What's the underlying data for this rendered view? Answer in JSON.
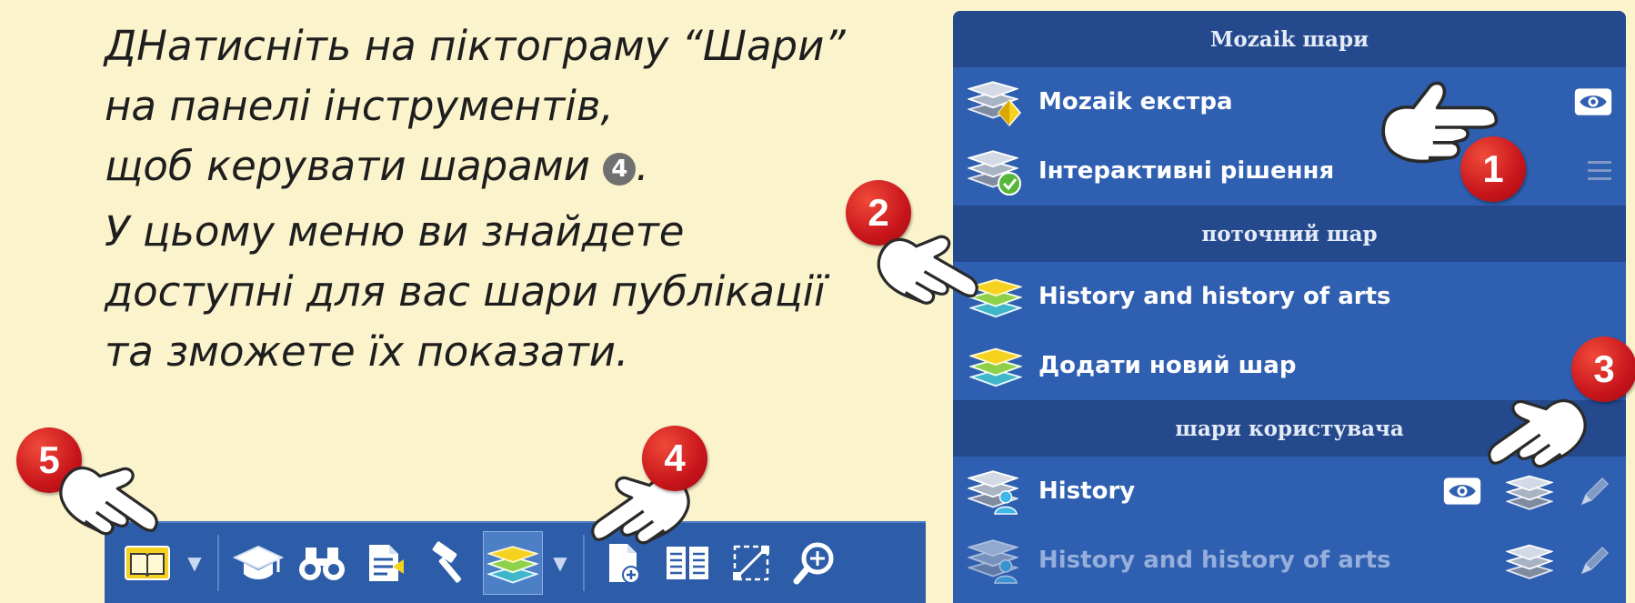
{
  "instructions": {
    "p1_line1": "ДНатисніть на піктограму “Шари”",
    "p1_line2": "на панелі інструментів,",
    "p1_line3": "щоб керувати шарами",
    "p1_badge": "4",
    "p1_end": ".",
    "p2_line1": "У цьому меню ви знайдете",
    "p2_line2": "доступні для вас шари публікації",
    "p2_line3": "та зможете їх показати."
  },
  "panel": {
    "section1_title": "Mozaik шари",
    "section2_title": "поточний шар",
    "section3_title": "шари користувача",
    "rows": [
      {
        "label": "Mozaik екстра",
        "icon": "layers-diamond-icon",
        "right": [
          "eye-icon"
        ]
      },
      {
        "label": "Інтерактивні рішення",
        "icon": "layers-check-icon",
        "right": [
          "menu-icon"
        ]
      },
      {
        "label": "History and history of arts",
        "icon": "layers-yellow-icon"
      },
      {
        "label": "Додати новий шар",
        "icon": "layers-yellow-icon"
      },
      {
        "label": "History",
        "icon": "layers-user-icon",
        "right": [
          "eye-icon",
          "layers-icon",
          "pencil-icon"
        ]
      },
      {
        "label": "History and history of arts",
        "icon": "layers-user-icon",
        "muted": true,
        "right": [
          "layers-icon",
          "pencil-icon"
        ]
      }
    ]
  },
  "toolbar": {
    "buttons": [
      "book-icon",
      "dropdown-icon",
      "graduation-cap-icon",
      "binoculars-icon",
      "notes-icon",
      "hammer-icon",
      "layers-icon",
      "dropdown-icon",
      "add-page-icon",
      "two-pages-icon",
      "crop-icon",
      "zoom-icon"
    ],
    "dropdown_glyph": "▼"
  },
  "callouts": [
    "1",
    "2",
    "3",
    "4",
    "5"
  ],
  "colors": {
    "background": "#fbf3cc",
    "panel": "#2f5fb0",
    "panel_header": "#24498c",
    "toolbar": "#2d5da8",
    "callout": "#c8151b",
    "accent_yellow": "#f5d21f"
  }
}
